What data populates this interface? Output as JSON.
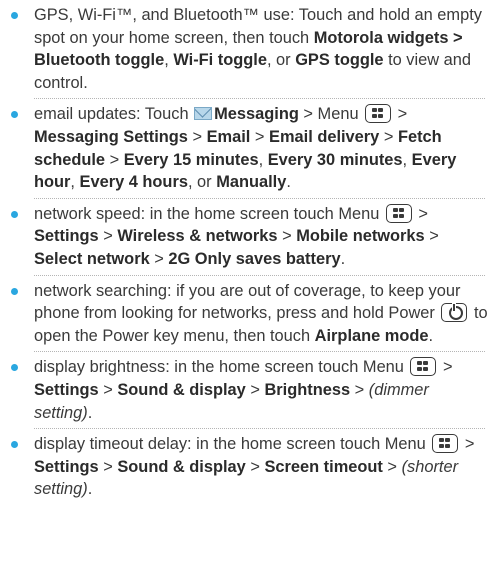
{
  "items": [
    {
      "t1": "GPS, Wi-Fi™, and Bluetooth™ use: Touch and hold an empty spot on your home screen, then touch ",
      "b1": "Motorola widgets > Bluetooth toggle",
      "t2": ", ",
      "b2": "Wi-Fi toggle",
      "t3": ", or ",
      "b3": "GPS toggle",
      "t4": " to view and control."
    },
    {
      "t1": "email updates: Touch ",
      "b1": "Messaging",
      "t2": " > Menu ",
      "t3": " > ",
      "b2": "Messaging Settings",
      "t4": " > ",
      "b3": "Email",
      "t5": " > ",
      "b4": "Email delivery",
      "t6": " > ",
      "b5": "Fetch schedule",
      "t7": " > ",
      "b6": "Every 15 minutes",
      "t8": ", ",
      "b7": "Every 30 minutes",
      "t9": ", ",
      "b8": "Every hour",
      "t10": ", ",
      "b9": "Every 4 hours",
      "t11": ", or ",
      "b10": "Manually",
      "t12": "."
    },
    {
      "t1": "network speed: in the home screen touch Menu ",
      "t2": " > ",
      "b1": "Settings",
      "t3": " > ",
      "b2": "Wireless & networks",
      "t4": " > ",
      "b3": "Mobile networks",
      "t5": " > ",
      "b4": "Select network",
      "t6": " > ",
      "b5": "2G Only saves battery",
      "t7": "."
    },
    {
      "t1": "network searching: if you are out of coverage, to keep your phone from looking for networks, press and hold Power ",
      "t2": " to open the Power key menu, then touch ",
      "b1": "Airplane mode",
      "t3": "."
    },
    {
      "t1": "display brightness: in the home screen touch Menu ",
      "t2": " > ",
      "b1": "Settings",
      "t3": " > ",
      "b2": "Sound & display",
      "t4": " > ",
      "b3": "Brightness",
      "t5": " > ",
      "i1": "(dimmer setting)",
      "t6": "."
    },
    {
      "t1": "display timeout delay: in the home screen touch Menu ",
      "t2": " > ",
      "b1": "Settings",
      "t3": " > ",
      "b2": "Sound & display",
      "t4": " > ",
      "b3": "Screen timeout",
      "t5": " > ",
      "i1": "(shorter setting)",
      "t6": "."
    }
  ],
  "icons": {
    "bullet_color": "#2aa7e0",
    "messaging": "envelope-icon",
    "menu": "menu-key-icon",
    "power": "power-key-icon"
  }
}
